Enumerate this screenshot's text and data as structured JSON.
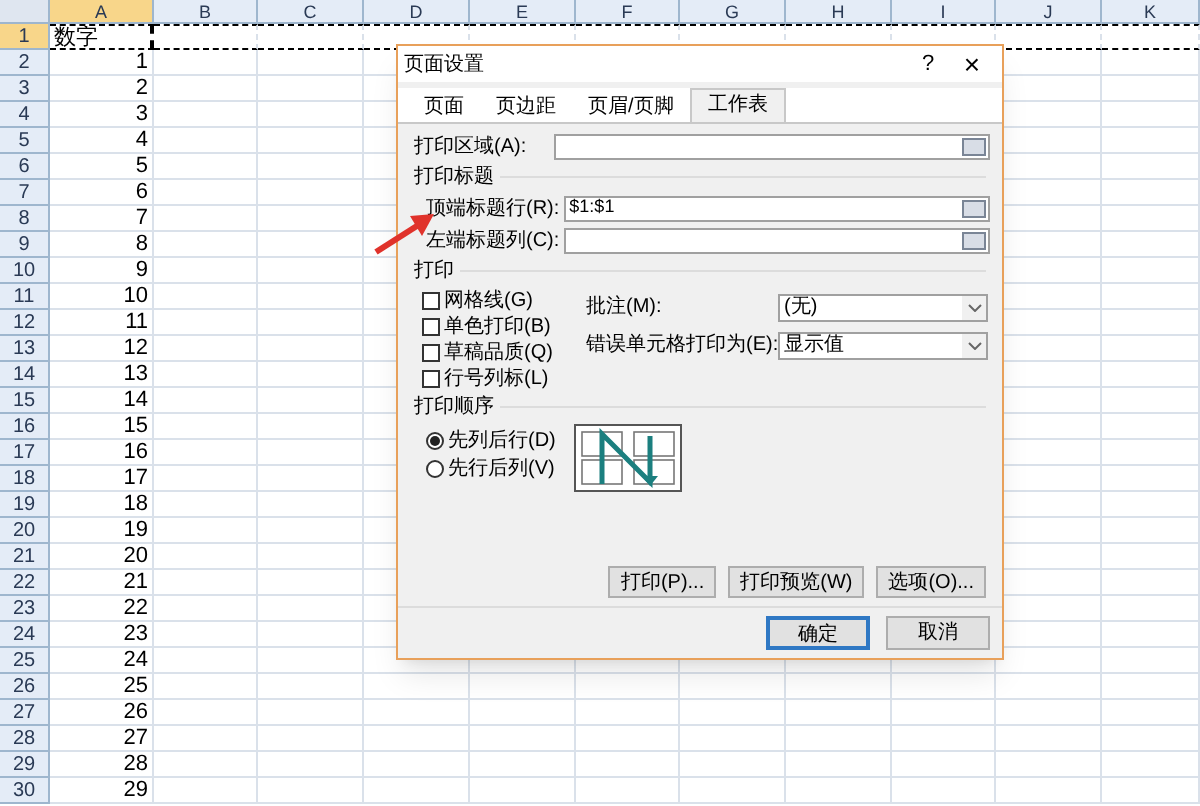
{
  "sheet": {
    "columns": [
      {
        "label": "A",
        "selected": true
      },
      {
        "label": "B",
        "selected": false
      },
      {
        "label": "C",
        "selected": false
      },
      {
        "label": "D",
        "selected": false
      },
      {
        "label": "E",
        "selected": false
      },
      {
        "label": "F",
        "selected": false
      },
      {
        "label": "G",
        "selected": false
      },
      {
        "label": "H",
        "selected": false
      },
      {
        "label": "I",
        "selected": false
      },
      {
        "label": "J",
        "selected": false
      },
      {
        "label": "K",
        "selected": false
      }
    ],
    "rows": [
      {
        "number": "1",
        "selected": true,
        "cell": "数字"
      },
      {
        "number": "2",
        "selected": false,
        "cell": "1"
      },
      {
        "number": "3",
        "selected": false,
        "cell": "2"
      },
      {
        "number": "4",
        "selected": false,
        "cell": "3"
      },
      {
        "number": "5",
        "selected": false,
        "cell": "4"
      },
      {
        "number": "6",
        "selected": false,
        "cell": "5"
      },
      {
        "number": "7",
        "selected": false,
        "cell": "6"
      },
      {
        "number": "8",
        "selected": false,
        "cell": "7"
      },
      {
        "number": "9",
        "selected": false,
        "cell": "8"
      },
      {
        "number": "10",
        "selected": false,
        "cell": "9"
      },
      {
        "number": "11",
        "selected": false,
        "cell": "10"
      },
      {
        "number": "12",
        "selected": false,
        "cell": "11"
      },
      {
        "number": "13",
        "selected": false,
        "cell": "12"
      },
      {
        "number": "14",
        "selected": false,
        "cell": "13"
      },
      {
        "number": "15",
        "selected": false,
        "cell": "14"
      },
      {
        "number": "16",
        "selected": false,
        "cell": "15"
      },
      {
        "number": "17",
        "selected": false,
        "cell": "16"
      },
      {
        "number": "18",
        "selected": false,
        "cell": "17"
      },
      {
        "number": "19",
        "selected": false,
        "cell": "18"
      },
      {
        "number": "20",
        "selected": false,
        "cell": "19"
      },
      {
        "number": "21",
        "selected": false,
        "cell": "20"
      },
      {
        "number": "22",
        "selected": false,
        "cell": "21"
      },
      {
        "number": "23",
        "selected": false,
        "cell": "22"
      },
      {
        "number": "24",
        "selected": false,
        "cell": "23"
      },
      {
        "number": "25",
        "selected": false,
        "cell": "24"
      },
      {
        "number": "26",
        "selected": false,
        "cell": "25"
      },
      {
        "number": "27",
        "selected": false,
        "cell": "26"
      },
      {
        "number": "28",
        "selected": false,
        "cell": "27"
      },
      {
        "number": "29",
        "selected": false,
        "cell": "28"
      },
      {
        "number": "30",
        "selected": false,
        "cell": "29"
      }
    ]
  },
  "dialog": {
    "title": "页面设置",
    "help": "?",
    "close": "×",
    "tabs": [
      {
        "label": "页面",
        "selected": false
      },
      {
        "label": "页边距",
        "selected": false
      },
      {
        "label": "页眉/页脚",
        "selected": false
      },
      {
        "label": "工作表",
        "selected": true
      }
    ],
    "print_area": {
      "label": "打印区域(A):"
    },
    "print_titles": {
      "heading": "打印标题",
      "fields": [
        {
          "label": "顶端标题行(R):",
          "value": "$1:$1"
        },
        {
          "label": "左端标题列(C):"
        }
      ]
    },
    "print": {
      "heading": "打印",
      "checkboxes": [
        {
          "label": "网格线(G)",
          "checked": false
        },
        {
          "label": "单色打印(B)",
          "checked": false
        },
        {
          "label": "草稿品质(Q)",
          "checked": false
        },
        {
          "label": "行号列标(L)",
          "checked": false
        }
      ],
      "selects": [
        {
          "label": "批注(M):",
          "value": "(无)"
        },
        {
          "label": "错误单元格打印为(E):",
          "value": "显示值"
        }
      ]
    },
    "page_order": {
      "heading": "打印顺序",
      "options": [
        {
          "label": "先列后行(D)",
          "selected": true
        },
        {
          "label": "先行后列(V)",
          "selected": false
        }
      ]
    },
    "buttons": [
      "打印(P)...",
      "打印预览(W)",
      "选项(O)..."
    ],
    "footer_buttons": [
      {
        "label": "确定",
        "default": true
      },
      {
        "label": "取消",
        "default": false
      }
    ]
  }
}
